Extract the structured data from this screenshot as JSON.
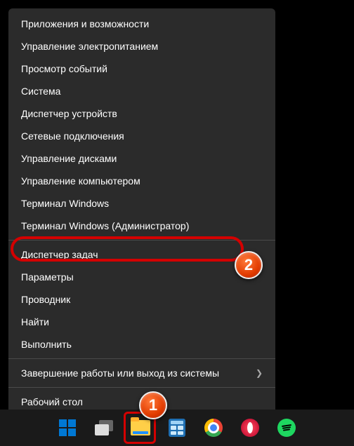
{
  "menu": {
    "items": [
      {
        "label": "Приложения и возможности"
      },
      {
        "label": "Управление электропитанием"
      },
      {
        "label": "Просмотр событий"
      },
      {
        "label": "Система"
      },
      {
        "label": "Диспетчер устройств"
      },
      {
        "label": "Сетевые подключения"
      },
      {
        "label": "Управление дисками"
      },
      {
        "label": "Управление компьютером"
      },
      {
        "label": "Терминал Windows"
      },
      {
        "label": "Терминал Windows (Администратор)"
      }
    ],
    "items2": [
      {
        "label": "Диспетчер задач"
      },
      {
        "label": "Параметры"
      },
      {
        "label": "Проводник"
      },
      {
        "label": "Найти"
      },
      {
        "label": "Выполнить"
      }
    ],
    "items3": [
      {
        "label": "Завершение работы или выход из системы",
        "submenu": true
      }
    ],
    "items4": [
      {
        "label": "Рабочий стол"
      }
    ]
  },
  "markers": {
    "one": "1",
    "two": "2"
  },
  "taskbar": {
    "start": "start-button",
    "taskview": "task-view",
    "explorer": "file-explorer",
    "calculator": "calculator",
    "chrome": "google-chrome",
    "opera": "opera-gx",
    "spotify": "spotify"
  },
  "colors": {
    "highlight": "#d40000",
    "menu_bg": "#2b2b2b"
  }
}
